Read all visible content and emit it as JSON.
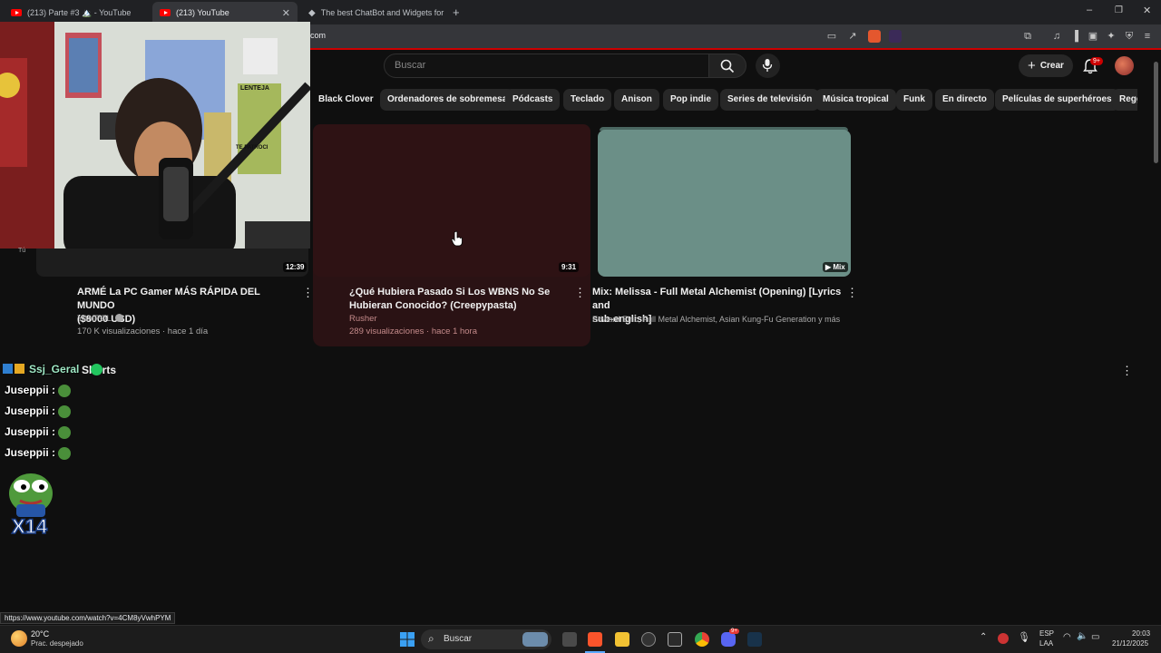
{
  "tabs": [
    {
      "label": "(213) Parte #3 🏔️ - YouTube"
    },
    {
      "label": "(213) YouTube"
    },
    {
      "label": "The best ChatBot and Widgets for K"
    }
  ],
  "address": {
    "url_fragment": "com"
  },
  "header": {
    "search_placeholder": "Buscar",
    "create_label": "Crear",
    "notifications_badge": "9+"
  },
  "chips": [
    "Black Clover",
    "Ordenadores de sobremesa",
    "Pódcasts",
    "Teclado",
    "Anison",
    "Pop indie",
    "Series de televisión",
    "Música tropical",
    "Funk",
    "En directo",
    "Películas de superhéroes",
    "Regg"
  ],
  "videos": [
    {
      "title_line1": "ARMÉ La PC Gamer MÁS RÁPIDA DEL MUNDO",
      "title_line2": "($8000 USD)",
      "channel": "YANPOL",
      "stats": "170 K visualizaciones · hace 1 día",
      "duration": "12:39"
    },
    {
      "title_line1": "¿Qué Hubiera Pasado Si Los WBNS No Se",
      "title_line2": "Hubieran Conocido? (Creepypasta)",
      "channel": "Rusher",
      "stats": "289 visualizaciones · hace 1 hora",
      "duration": "9:31"
    },
    {
      "title_line1": "Mix: Melissa - Full Metal Alchemist (Opening) [Lyrics and",
      "title_line2": "sub-english]",
      "channel": "Edward Elric, Full Metal Alchemist, Asian Kung-Fu Generation y más",
      "badge": "Mix"
    }
  ],
  "webcam": {
    "poster_text_1": "LENTEJA",
    "poster_text_2": "TE PATROCI",
    "small_label": "Tú"
  },
  "shorts": {
    "label": "Shorts"
  },
  "chat": {
    "follower": "Ssj_Geral",
    "lines": [
      "Juseppii :",
      "Juseppii :",
      "Juseppii :",
      "Juseppii :"
    ],
    "combo": "X14"
  },
  "status_url": "https://www.youtube.com/watch?v=4CM8yVwhPYM",
  "taskbar": {
    "weather_temp": "20°C",
    "weather_desc": "Prac. despejado",
    "search_label": "Buscar",
    "lang_1": "ESP",
    "lang_2": "LAA",
    "time": "20:03",
    "date": "21/12/2025",
    "discord_badge": "9+"
  },
  "colors": {
    "yt_red": "#ff0000",
    "accent_red": "#cc0000",
    "mix_thumb": "#6b8f87",
    "hover_card": "#2a1214"
  }
}
